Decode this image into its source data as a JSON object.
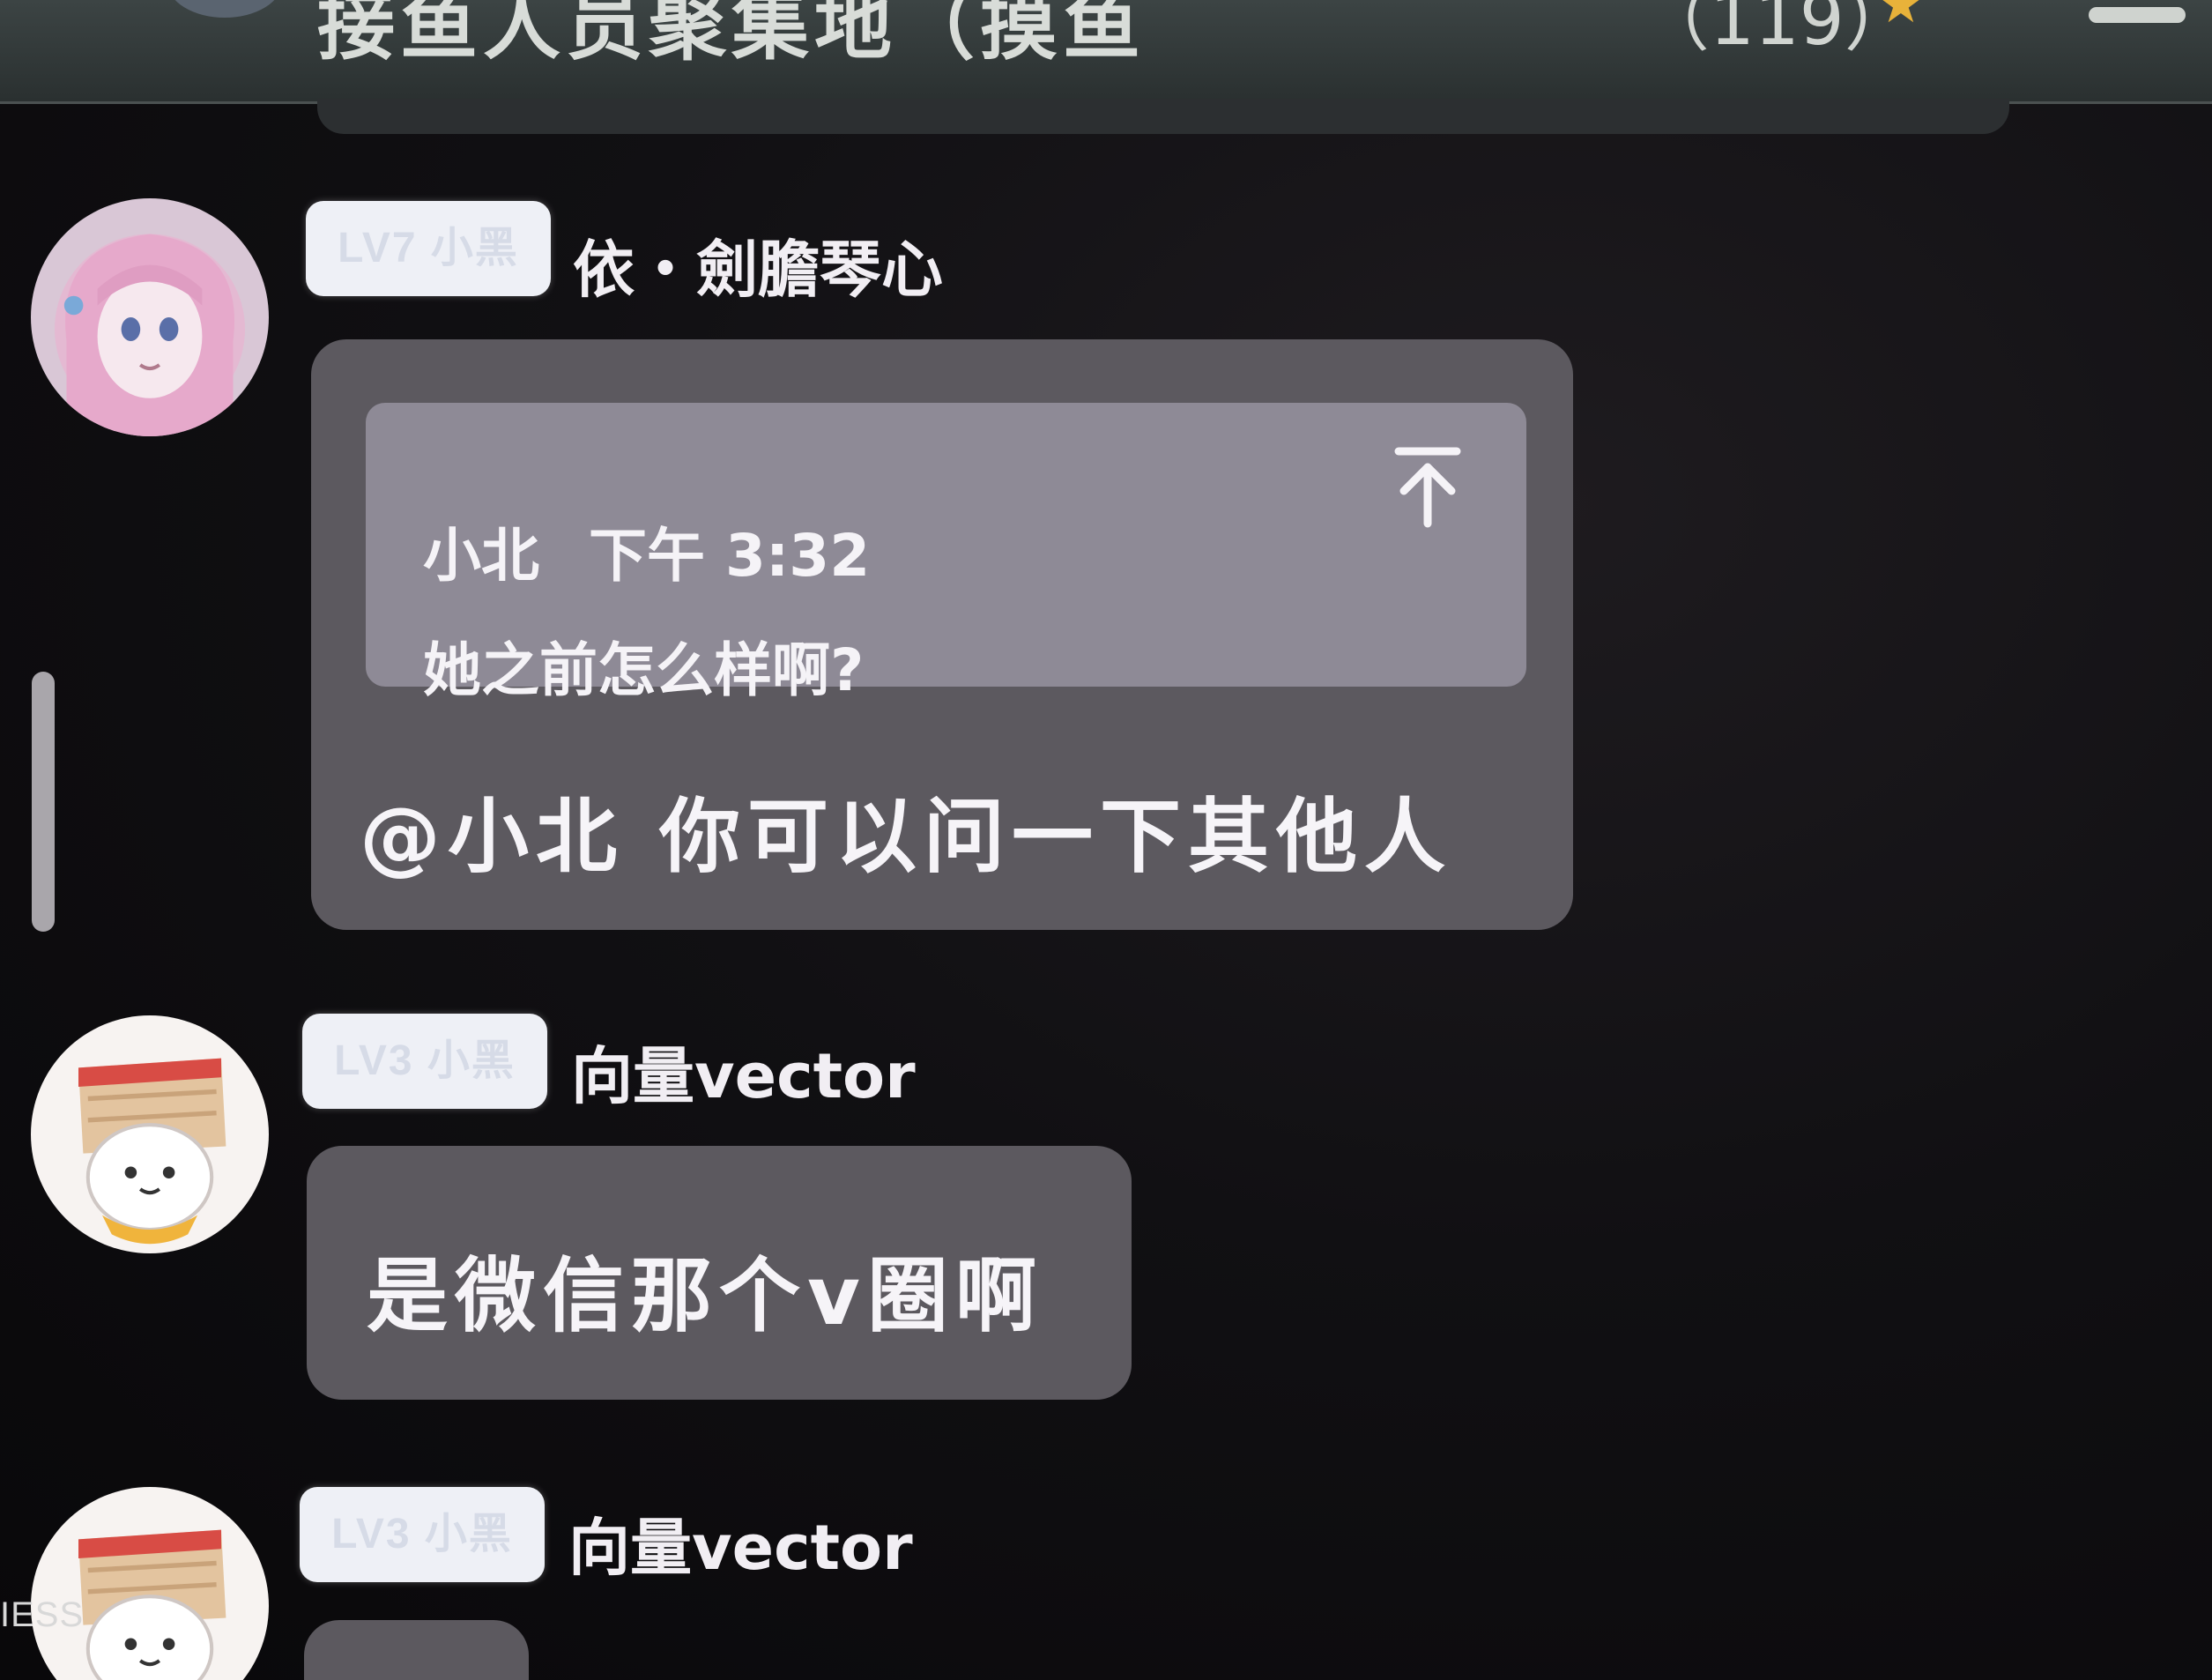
{
  "header": {
    "title": "接鱼人员聚集地（摸鱼",
    "member_count": "（119）",
    "star_icon": "star-icon",
    "menu_icon": "menu-icon"
  },
  "messages": [
    {
      "username": "依・劍膽琴心",
      "level_badge": "LV7 小黑",
      "avatar_icon": "pink-hair-girl-avatar",
      "quote": {
        "author": "小北",
        "time": "下午 3:32",
        "text": "她之前怎么样啊?",
        "jump_icon": "jump-to-top-icon"
      },
      "text": "@小北 你可以问一下其他人"
    },
    {
      "username": "向量vector",
      "level_badge": "LV3 小黑",
      "avatar_icon": "bread-cat-avatar",
      "text": "是微信那个v圈啊"
    },
    {
      "username": "向量vector",
      "level_badge": "LV3 小黑",
      "avatar_icon": "bread-cat-avatar",
      "text": ""
    }
  ],
  "overlay": {
    "watermark": "IESS"
  },
  "colors": {
    "background": "#0b0a0c",
    "bubble": "#5c595f",
    "quote": "#8e8a96",
    "badge": "#eef0f6",
    "text": "#f6f4f8"
  }
}
